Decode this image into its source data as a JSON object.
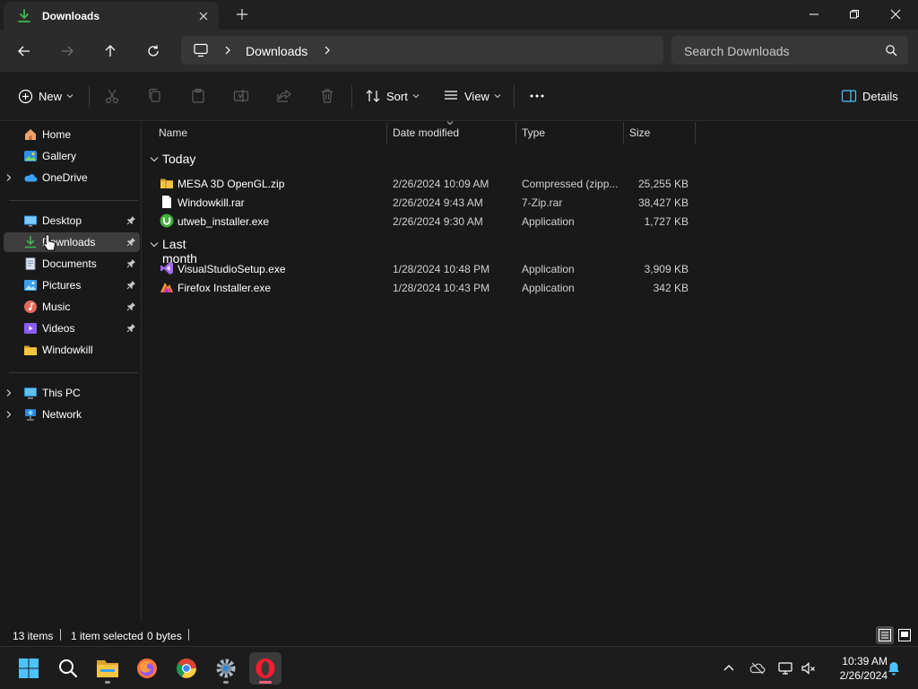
{
  "window": {
    "tab_title": "Downloads",
    "tab_icon": "downloads-icon",
    "controls": [
      "minimize-icon",
      "restore-icon",
      "close-icon"
    ]
  },
  "address": {
    "root_icon": "this-pc-icon",
    "breadcrumb": [
      "Downloads"
    ],
    "search_placeholder": "Search Downloads"
  },
  "toolbar": {
    "new_label": "New",
    "sort_label": "Sort",
    "view_label": "View",
    "details_label": "Details",
    "disabled_actions": [
      "cut-icon",
      "copy-icon",
      "paste-icon",
      "rename-icon",
      "share-icon",
      "delete-icon"
    ]
  },
  "sidebar": {
    "items": [
      {
        "label": "Home",
        "icon": "home-icon",
        "pinned": false,
        "expandable": false
      },
      {
        "label": "Gallery",
        "icon": "gallery-icon",
        "pinned": false,
        "expandable": false
      },
      {
        "label": "OneDrive",
        "icon": "onedrive-icon",
        "pinned": false,
        "expandable": true
      },
      {
        "label": "Desktop",
        "icon": "desktop-icon",
        "pinned": true,
        "expandable": false
      },
      {
        "label": "Downloads",
        "icon": "downloads-icon",
        "pinned": true,
        "expandable": false,
        "selected": true
      },
      {
        "label": "Documents",
        "icon": "documents-icon",
        "pinned": true,
        "expandable": false
      },
      {
        "label": "Pictures",
        "icon": "pictures-icon",
        "pinned": true,
        "expandable": false
      },
      {
        "label": "Music",
        "icon": "music-icon",
        "pinned": true,
        "expandable": false
      },
      {
        "label": "Videos",
        "icon": "videos-icon",
        "pinned": true,
        "expandable": false
      },
      {
        "label": "Windowkill",
        "icon": "folder-icon",
        "pinned": false,
        "expandable": false
      },
      {
        "label": "This PC",
        "icon": "this-pc-icon",
        "pinned": false,
        "expandable": true
      },
      {
        "label": "Network",
        "icon": "network-icon",
        "pinned": false,
        "expandable": true
      }
    ]
  },
  "columns": [
    "Name",
    "Date modified",
    "Type",
    "Size"
  ],
  "groups": [
    {
      "label": "Today",
      "files": [
        {
          "name": "MESA 3D OpenGL.zip",
          "date": "2/26/2024 10:09 AM",
          "type": "Compressed (zipp...",
          "size": "25,255 KB",
          "icon": "zip-folder-icon"
        },
        {
          "name": "Windowkill.rar",
          "date": "2/26/2024 9:43 AM",
          "type": "7-Zip.rar",
          "size": "38,427 KB",
          "icon": "file-icon"
        },
        {
          "name": "utweb_installer.exe",
          "date": "2/26/2024 9:30 AM",
          "type": "Application",
          "size": "1,727 KB",
          "icon": "utorrent-icon"
        }
      ]
    },
    {
      "label": "Last month",
      "files": [
        {
          "name": "VisualStudioSetup.exe",
          "date": "1/28/2024 10:48 PM",
          "type": "Application",
          "size": "3,909 KB",
          "icon": "visual-studio-icon"
        },
        {
          "name": "Firefox Installer.exe",
          "date": "1/28/2024 10:43 PM",
          "type": "Application",
          "size": "342 KB",
          "icon": "firefox-installer-icon"
        }
      ]
    }
  ],
  "status": {
    "item_count": "13 items",
    "selection": "1 item selected",
    "selection_size": "0 bytes"
  },
  "taskbar": {
    "apps": [
      "start-icon",
      "search-icon",
      "file-explorer-icon",
      "firefox-icon",
      "chrome-icon",
      "settings-icon",
      "opera-icon"
    ],
    "tray": [
      "show-hidden-icons-icon",
      "onedrive-icon",
      "network-icon",
      "volume-muted-icon"
    ],
    "time": "10:39 AM",
    "date": "2/26/2024"
  },
  "colors": {
    "accent_green": "#3fb950",
    "folder_yellow": "#f5c542",
    "selection_gray": "#3d3d3d",
    "opera_red": "#ff1b2d",
    "notification_blue": "#4cc2ff"
  }
}
